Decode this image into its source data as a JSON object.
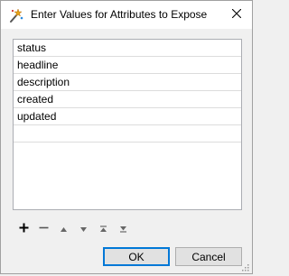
{
  "window": {
    "title": "Enter Values for Attributes to Expose",
    "icon": "wizard-wand-icon"
  },
  "attributes": {
    "items": [
      "status",
      "headline",
      "description",
      "created",
      "updated",
      ""
    ]
  },
  "toolbar": {
    "add": "+",
    "remove": "—",
    "move_up": "▲",
    "move_down": "▼",
    "move_top": "⤒",
    "move_bottom": "⤓"
  },
  "buttons": {
    "ok_label": "OK",
    "cancel_label": "Cancel"
  },
  "colors": {
    "accent": "#0078d7",
    "row_border": "#dcdcdc",
    "button_bg": "#e1e1e1"
  }
}
